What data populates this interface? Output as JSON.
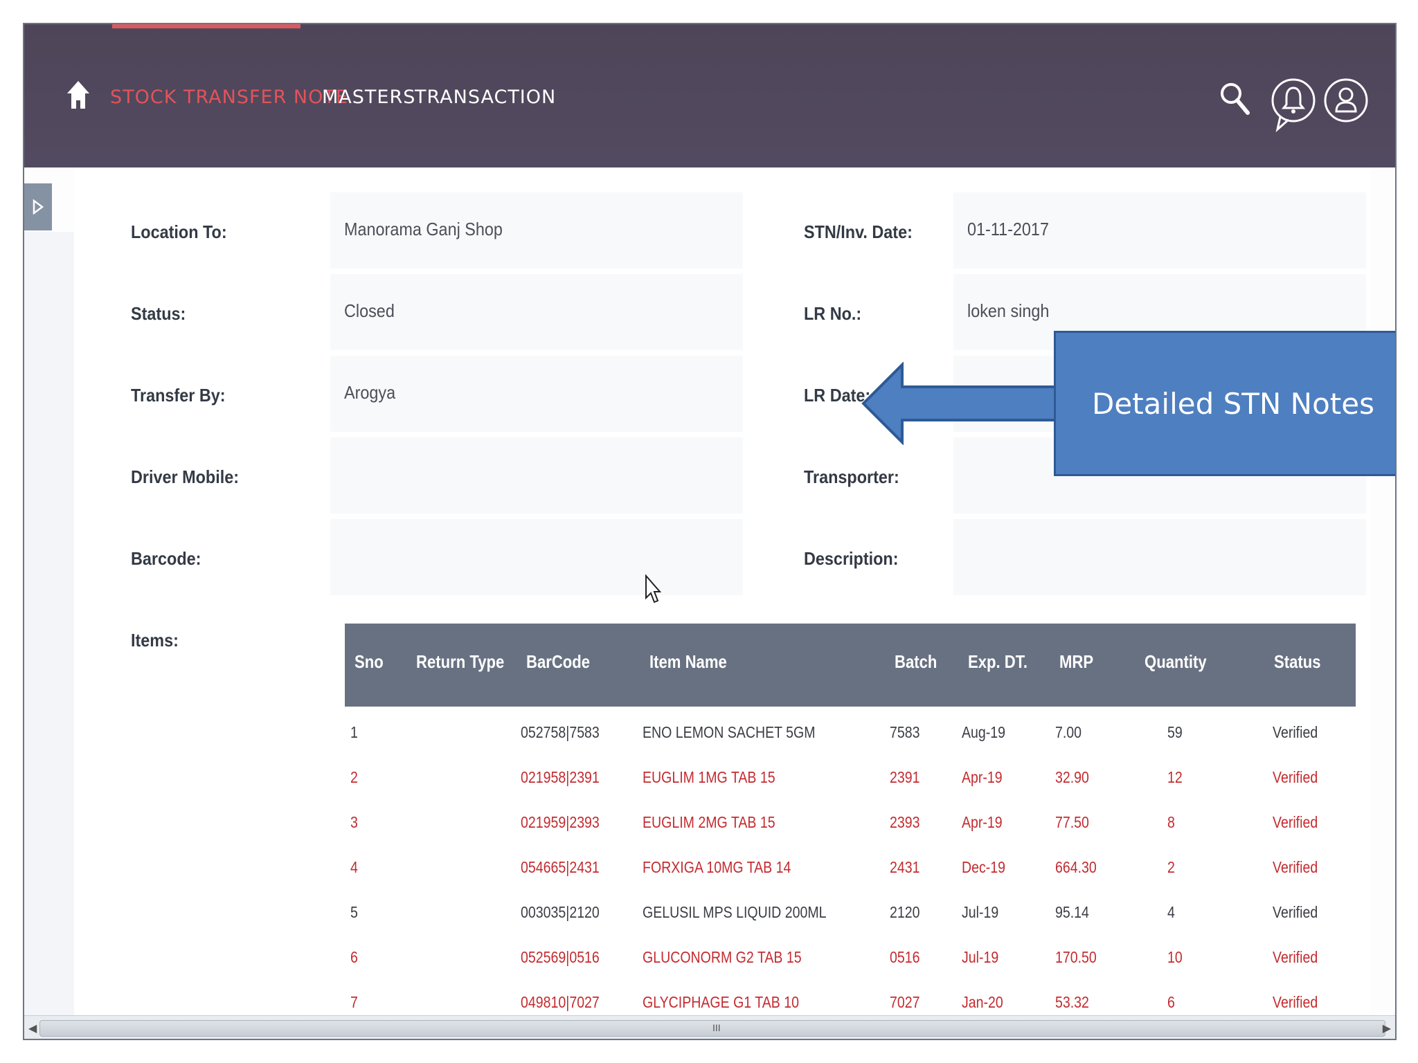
{
  "nav": {
    "items": [
      {
        "label": "STOCK TRANSFER NOTE",
        "active": true
      },
      {
        "label": "MASTERS",
        "active": false
      },
      {
        "label": "TRANSACTION",
        "active": false
      }
    ],
    "icons": [
      "home-icon",
      "search-icon",
      "bell-icon",
      "user-icon"
    ],
    "active_color": "#e2535b",
    "bar_color": "#524a60"
  },
  "form": {
    "left": [
      {
        "label": "Location To:",
        "value": "Manorama Ganj Shop"
      },
      {
        "label": "Status:",
        "value": "Closed"
      },
      {
        "label": "Transfer By:",
        "value": "Arogya"
      },
      {
        "label": "Driver Mobile:",
        "value": ""
      },
      {
        "label": "Barcode:",
        "value": ""
      }
    ],
    "right": [
      {
        "label": "STN/Inv. Date:",
        "value": "01-11-2017"
      },
      {
        "label": "LR No.:",
        "value": "loken singh"
      },
      {
        "label": "LR Date:",
        "value": ""
      },
      {
        "label": "Transporter:",
        "value": ""
      },
      {
        "label": "Description:",
        "value": ""
      }
    ],
    "items_label": "Items:"
  },
  "table": {
    "columns": [
      "Sno",
      "Return Type",
      "BarCode",
      "Item Name",
      "Batch",
      "Exp. DT.",
      "MRP",
      "Quantity",
      "Status"
    ],
    "rows": [
      {
        "sno": "1",
        "return_type": "",
        "barcode": "052758|7583",
        "item": "ENO LEMON SACHET 5GM",
        "batch": "7583",
        "exp": "Aug-19",
        "mrp": "7.00",
        "qty": "59",
        "status": "Verified",
        "highlight": false
      },
      {
        "sno": "2",
        "return_type": "",
        "barcode": "021958|2391",
        "item": "EUGLIM 1MG TAB 15",
        "batch": "2391",
        "exp": "Apr-19",
        "mrp": "32.90",
        "qty": "12",
        "status": "Verified",
        "highlight": true
      },
      {
        "sno": "3",
        "return_type": "",
        "barcode": "021959|2393",
        "item": "EUGLIM 2MG TAB 15",
        "batch": "2393",
        "exp": "Apr-19",
        "mrp": "77.50",
        "qty": "8",
        "status": "Verified",
        "highlight": true
      },
      {
        "sno": "4",
        "return_type": "",
        "barcode": "054665|2431",
        "item": "FORXIGA 10MG TAB 14",
        "batch": "2431",
        "exp": "Dec-19",
        "mrp": "664.30",
        "qty": "2",
        "status": "Verified",
        "highlight": true
      },
      {
        "sno": "5",
        "return_type": "",
        "barcode": "003035|2120",
        "item": "GELUSIL MPS LIQUID 200ML",
        "batch": "2120",
        "exp": "Jul-19",
        "mrp": "95.14",
        "qty": "4",
        "status": "Verified",
        "highlight": false
      },
      {
        "sno": "6",
        "return_type": "",
        "barcode": "052569|0516",
        "item": "GLUCONORM G2 TAB 15",
        "batch": "0516",
        "exp": "Jul-19",
        "mrp": "170.50",
        "qty": "10",
        "status": "Verified",
        "highlight": true
      },
      {
        "sno": "7",
        "return_type": "",
        "barcode": "049810|7027",
        "item": "GLYCIPHAGE G1 TAB 10",
        "batch": "7027",
        "exp": "Jan-20",
        "mrp": "53.32",
        "qty": "6",
        "status": "Verified",
        "highlight": true
      }
    ],
    "header_color": "#687181",
    "highlight_color": "#c42a2f"
  },
  "callout": {
    "text": "Detailed STN Notes",
    "color": "#4e7fc0"
  },
  "scrollbar": {
    "grip": "III"
  }
}
